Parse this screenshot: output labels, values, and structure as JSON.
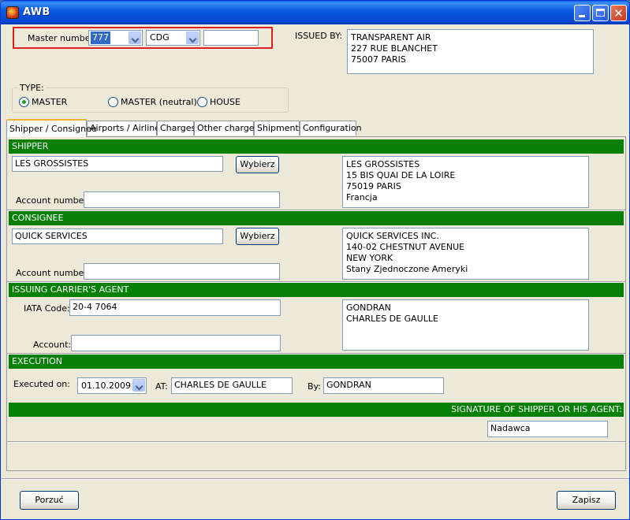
{
  "window": {
    "title": "AWB"
  },
  "master": {
    "label": "Master number:",
    "prefix": "777",
    "airport": "CDG",
    "number": ""
  },
  "issued_by": {
    "label": "ISSUED BY:",
    "lines": [
      "TRANSPARENT AIR",
      "227 RUE BLANCHET",
      "75007 PARIS"
    ]
  },
  "type": {
    "legend": "TYPE:",
    "options": [
      "MASTER",
      "MASTER (neutral)",
      "HOUSE"
    ],
    "selected": "MASTER"
  },
  "tabs": [
    "Shipper / Consignee",
    "Airports / Airlines",
    "Charges",
    "Other charges",
    "Shipments",
    "Configuration"
  ],
  "shipper": {
    "header": "SHIPPER",
    "name": "LES GROSSISTES",
    "choose_label": "Wybierz",
    "account_label": "Account number:",
    "account": "",
    "address": [
      "LES GROSSISTES",
      "15 BIS QUAI DE LA LOIRE",
      "75019 PARIS",
      "Francja"
    ]
  },
  "consignee": {
    "header": "CONSIGNEE",
    "name": "QUICK SERVICES",
    "choose_label": "Wybierz",
    "account_label": "Account number:",
    "account": "",
    "address": [
      "QUICK SERVICES INC.",
      "140-02 CHESTNUT AVENUE",
      "NEW YORK",
      "Stany Zjednoczone Ameryki"
    ]
  },
  "agent": {
    "header": "ISSUING CARRIER'S AGENT",
    "iata_label": "IATA Code:",
    "iata": "20-4 7064",
    "account_label": "Account:",
    "account": "",
    "address": [
      "GONDRAN",
      "CHARLES DE GAULLE"
    ]
  },
  "execution": {
    "header": "EXECUTION",
    "executed_on_label": "Executed on:",
    "date": "01.10.2009",
    "at_label": "AT:",
    "at": "CHARLES DE GAULLE",
    "by_label": "By:",
    "by": "GONDRAN"
  },
  "signature": {
    "header": "SIGNATURE OF SHIPPER OR HIS AGENT:",
    "value": "Nadawca"
  },
  "footer": {
    "cancel_label": "Porzuć",
    "save_label": "Zapisz"
  },
  "colors": {
    "section_green": "#068006",
    "title_blue": "#0548d0",
    "highlight_red": "#e02020"
  }
}
